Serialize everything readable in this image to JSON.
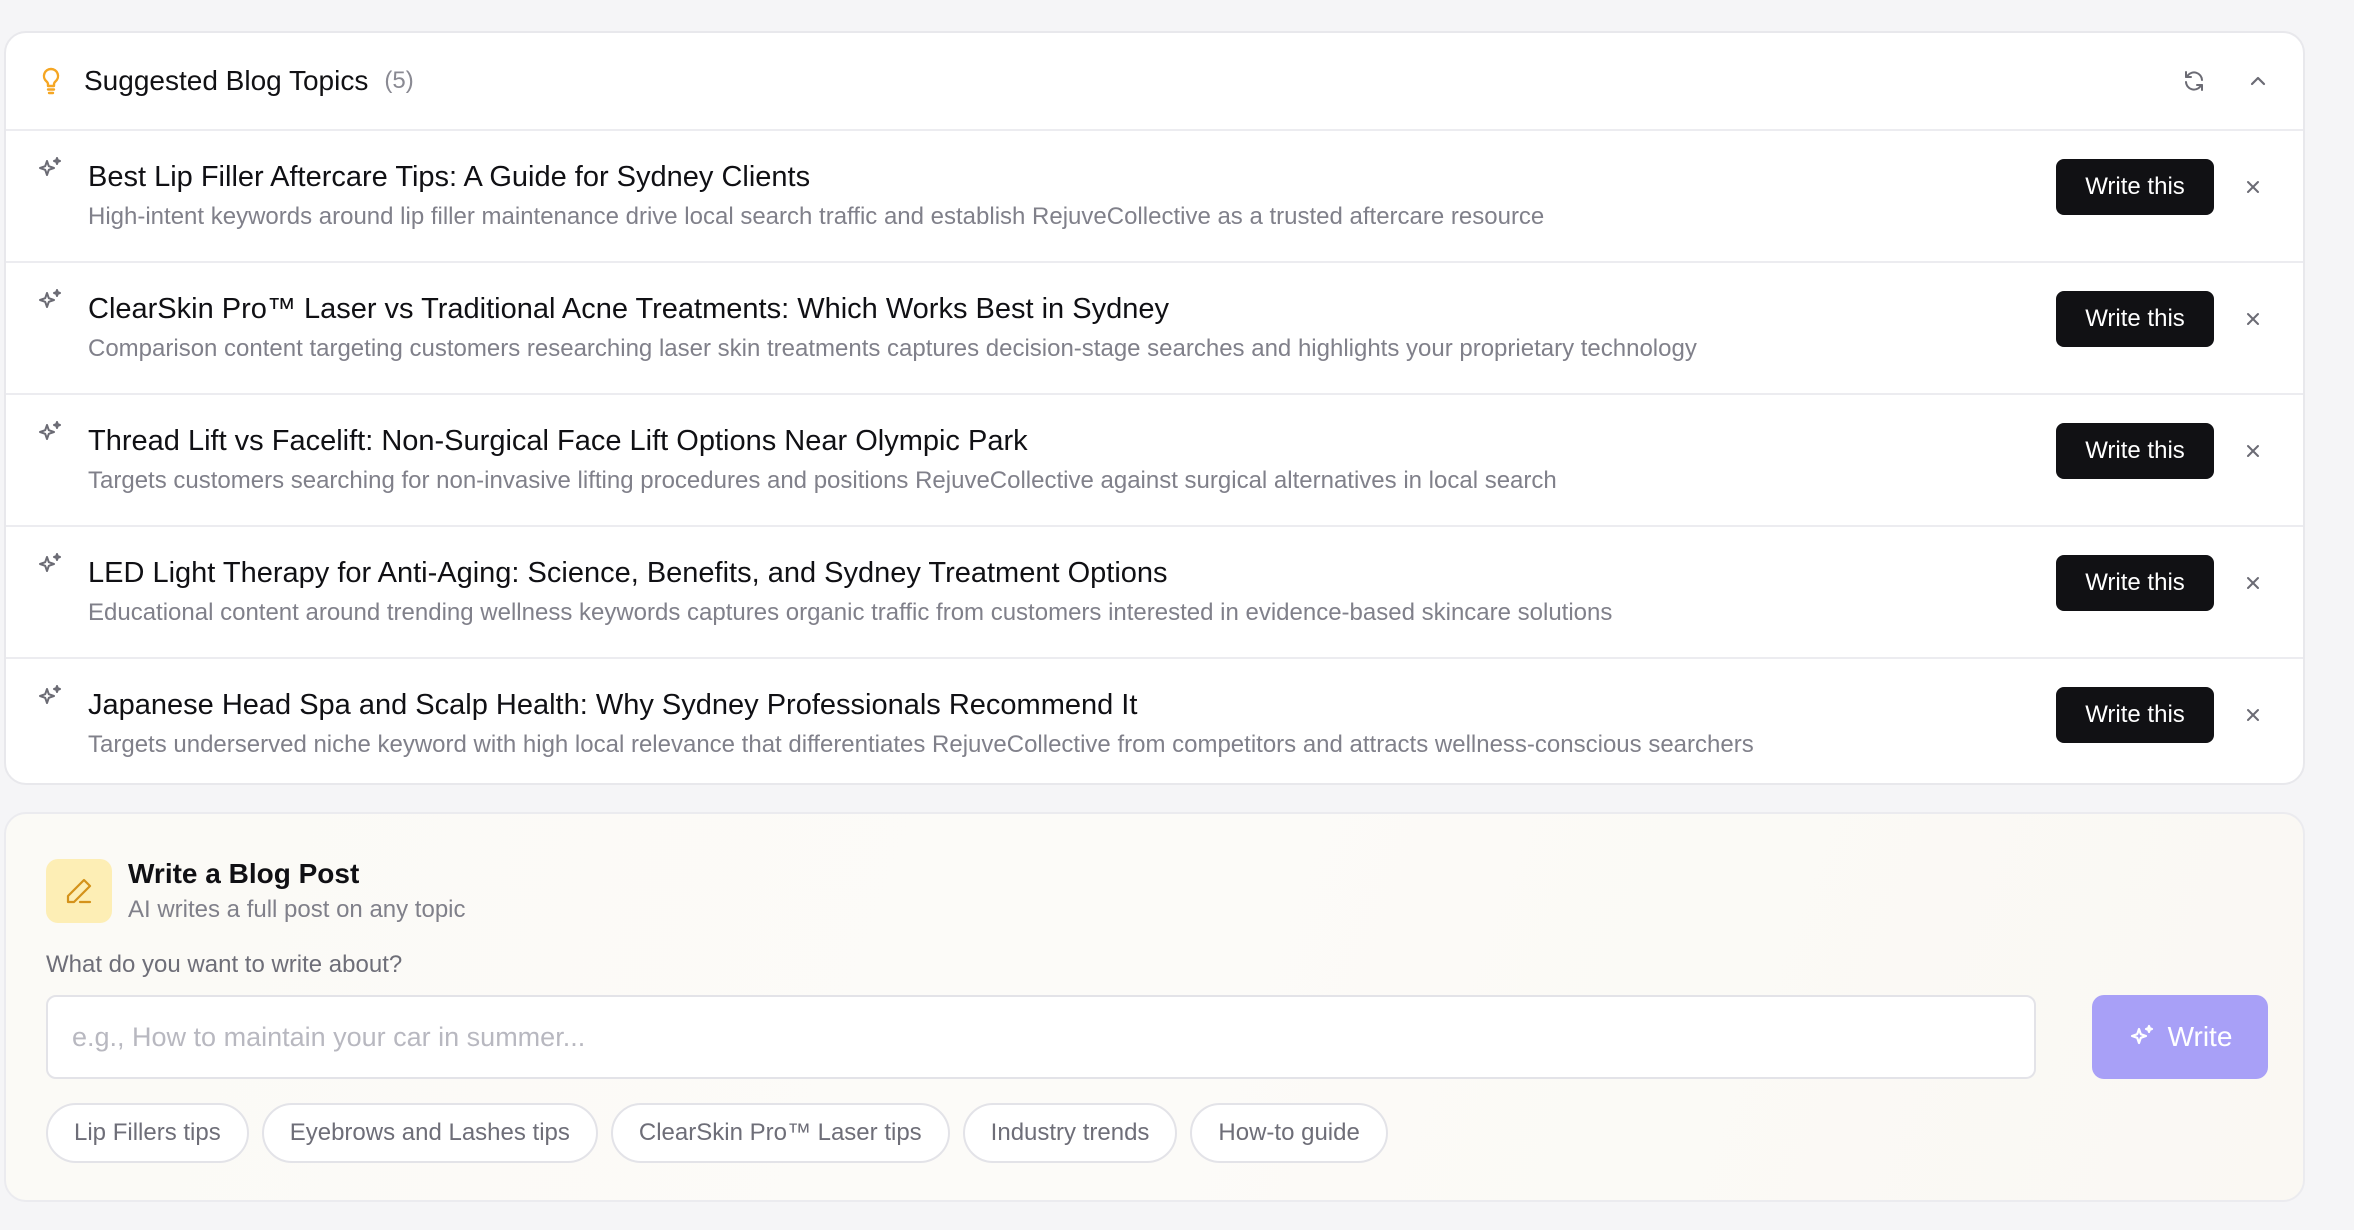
{
  "suggestions": {
    "title": "Suggested Blog Topics",
    "count": "(5)",
    "header_icons": [
      "lightbulb-icon",
      "refresh-icon",
      "chevron-up-icon"
    ],
    "items": [
      {
        "title": "Best Lip Filler Aftercare Tips: A Guide for Sydney Clients",
        "description": "High-intent keywords around lip filler maintenance drive local search traffic and establish RejuveCollective as a trusted aftercare resource",
        "button": "Write this"
      },
      {
        "title": "ClearSkin Pro™ Laser vs Traditional Acne Treatments: Which Works Best in Sydney",
        "description": "Comparison content targeting customers researching laser skin treatments captures decision-stage searches and highlights your proprietary technology",
        "button": "Write this"
      },
      {
        "title": "Thread Lift vs Facelift: Non-Surgical Face Lift Options Near Olympic Park",
        "description": "Targets customers searching for non-invasive lifting procedures and positions RejuveCollective against surgical alternatives in local search",
        "button": "Write this"
      },
      {
        "title": "LED Light Therapy for Anti-Aging: Science, Benefits, and Sydney Treatment Options",
        "description": "Educational content around trending wellness keywords captures organic traffic from customers interested in evidence-based skincare solutions",
        "button": "Write this"
      },
      {
        "title": "Japanese Head Spa and Scalp Health: Why Sydney Professionals Recommend It",
        "description": "Targets underserved niche keyword with high local relevance that differentiates RejuveCollective from competitors and attracts wellness-conscious searchers",
        "button": "Write this"
      }
    ]
  },
  "compose": {
    "title": "Write a Blog Post",
    "subtitle": "AI writes a full post on any topic",
    "prompt_label": "What do you want to write about?",
    "input_value": "",
    "input_placeholder": "e.g., How to maintain your car in summer...",
    "write_button": "Write",
    "chips": [
      "Lip Fillers tips",
      "Eyebrows and Lashes tips",
      "ClearSkin Pro™ Laser tips",
      "Industry trends",
      "How-to guide"
    ]
  },
  "colors": {
    "accent_icon": "#f5a623",
    "write_button_bg": "#a8a0f7",
    "primary_button_bg": "#111114",
    "pen_box_bg": "#fdeeb5"
  }
}
